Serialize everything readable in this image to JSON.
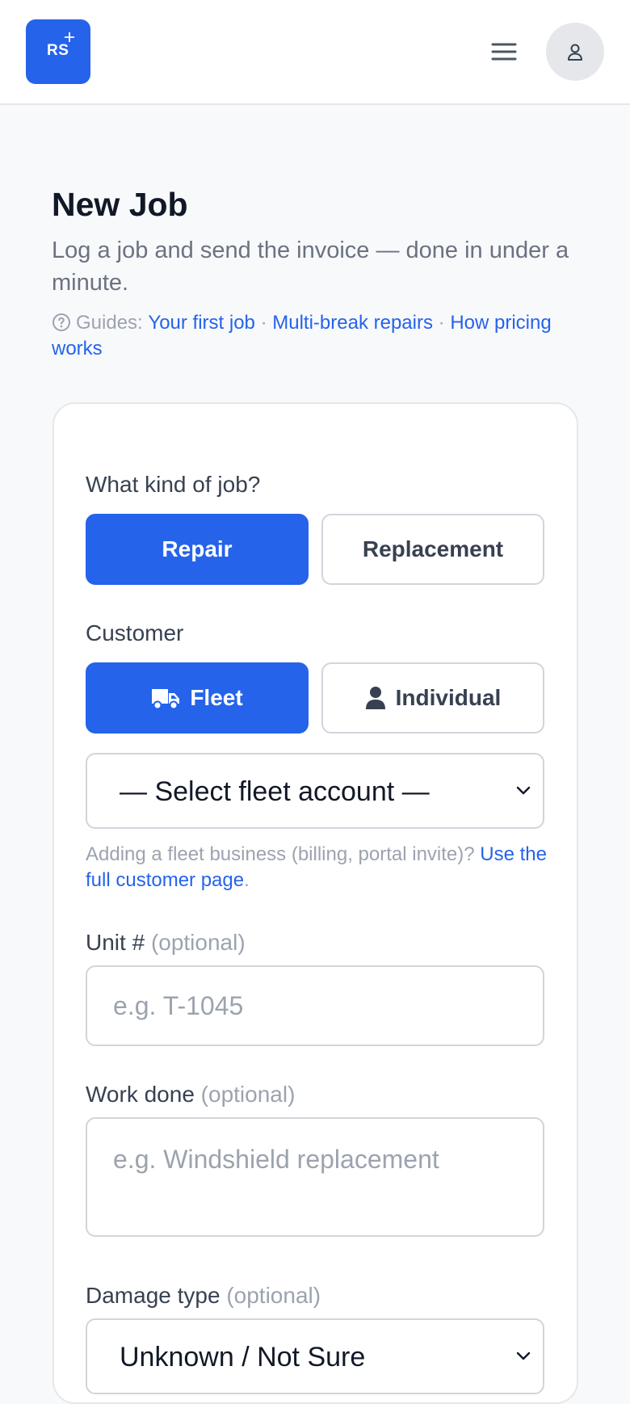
{
  "header": {
    "logo_text": "RS",
    "menu_icon": "hamburger-menu-icon",
    "avatar_icon": "user-icon"
  },
  "page": {
    "title": "New Job",
    "subtitle": "Log a job and send the invoice — done in under a minute.",
    "guides_label": "Guides:",
    "guides": [
      "Your first job",
      "Multi-break repairs",
      "How pricing works"
    ],
    "guides_separator": "·"
  },
  "form": {
    "job_kind_label": "What kind of job?",
    "job_kinds": [
      "Repair",
      "Replacement"
    ],
    "job_kind_selected": "Repair",
    "customer_label": "Customer",
    "customer_types": [
      "Fleet",
      "Individual"
    ],
    "customer_type_selected": "Fleet",
    "fleet_select_value": "— Select fleet account —",
    "hint_text": "Adding a fleet business (billing, portal invite)? ",
    "hint_link": "Use the full customer page",
    "hint_end": ".",
    "unit_label": "Unit #",
    "unit_optional": "(optional)",
    "unit_placeholder": "e.g. T-1045",
    "work_label": "Work done",
    "work_optional": "(optional)",
    "work_placeholder": "e.g. Windshield replacement",
    "damage_label": "Damage type",
    "damage_optional": "(optional)",
    "damage_value": "Unknown / Not Sure"
  },
  "colors": {
    "accent": "#2563eb",
    "text": "#111827",
    "muted": "#6b7280",
    "border": "#d1d5db",
    "background": "#f8f9fb"
  }
}
